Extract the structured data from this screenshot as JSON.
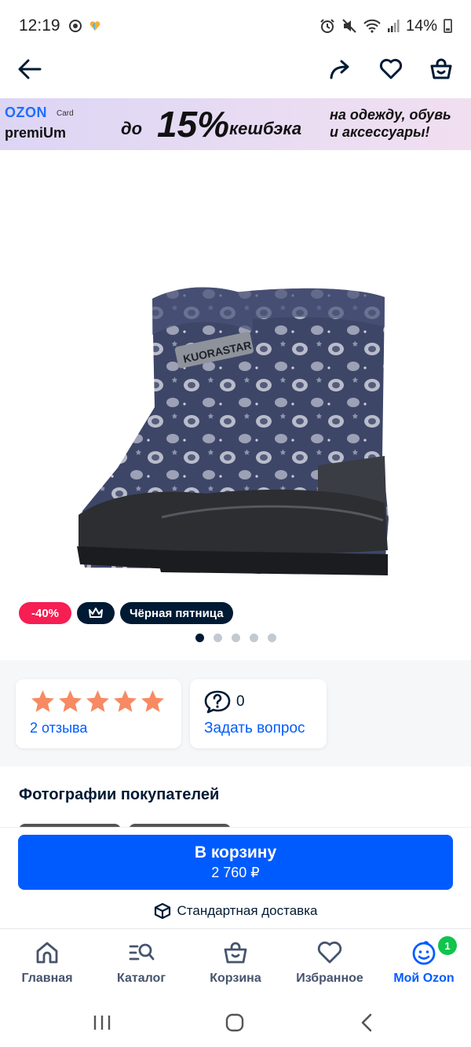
{
  "status_bar": {
    "time": "12:19",
    "battery": "14%"
  },
  "topnav": {
    "back_icon": "arrow-left-icon",
    "share_icon": "share-icon",
    "favorite_icon": "heart-icon",
    "cart_icon": "basket-icon"
  },
  "banner": {
    "brand": "OZON",
    "brand_card": "Card",
    "premium": "premiUm",
    "prefix": "до",
    "percent": "15%",
    "cashback": "кешбэка",
    "right_text_line1": "на одежду, обувь",
    "right_text_line2": "и аксессуары!",
    "colors": {
      "brand": "#1f6eff",
      "start": "#dcd5f4",
      "end": "#f1dff0"
    }
  },
  "product": {
    "image_alt": "Детские зимние сапоги с принтом",
    "boot_logo": "KUORASTAR"
  },
  "badges": {
    "discount": "-40%",
    "crown_icon": "crown-icon",
    "black_friday": "Чёрная пятница"
  },
  "gallery": {
    "dot_count": 5,
    "active_index": 0
  },
  "rating_card": {
    "stars": 5,
    "reviews_link": "2 отзыва",
    "star_color": "#f78a62"
  },
  "question_card": {
    "count": "0",
    "link": "Задать вопрос"
  },
  "customer_photos": {
    "title": "Фотографии покупателей"
  },
  "cart": {
    "button_label": "В корзину",
    "price": "2 760 ₽",
    "delivery": "Стандартная доставка",
    "accent": "#005bff"
  },
  "bottom_nav": {
    "items": [
      {
        "label": "Главная",
        "icon": "home-icon"
      },
      {
        "label": "Каталог",
        "icon": "catalog-search-icon"
      },
      {
        "label": "Корзина",
        "icon": "basket-icon"
      },
      {
        "label": "Избранное",
        "icon": "heart-icon"
      },
      {
        "label": "Мой Ozon",
        "icon": "smiley-icon",
        "badge": "1"
      }
    ]
  }
}
